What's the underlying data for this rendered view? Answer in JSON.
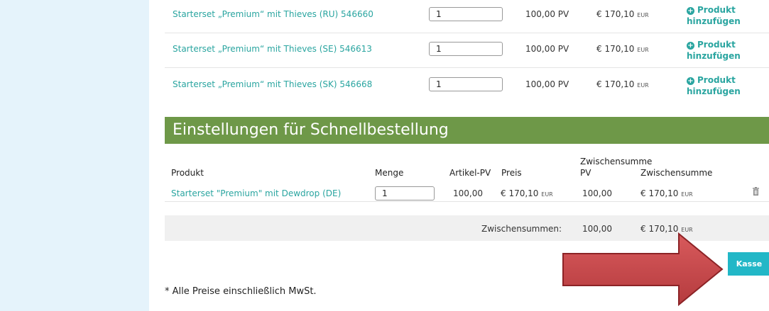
{
  "products": [
    {
      "name": "Starterset „Premium“ mit Thieves (RU) 546660",
      "qty": "1",
      "pv": "100,00 PV",
      "price": "€ 170,10",
      "currency": "EUR",
      "add_line1": "Produkt",
      "add_line2": "hinzufügen"
    },
    {
      "name": "Starterset „Premium“ mit Thieves (SE) 546613",
      "qty": "1",
      "pv": "100,00 PV",
      "price": "€ 170,10",
      "currency": "EUR",
      "add_line1": "Produkt",
      "add_line2": "hinzufügen"
    },
    {
      "name": "Starterset „Premium“ mit Thieves (SK) 546668",
      "qty": "1",
      "pv": "100,00 PV",
      "price": "€ 170,10",
      "currency": "EUR",
      "add_line1": "Produkt",
      "add_line2": "hinzufügen"
    }
  ],
  "quick_order": {
    "title": "Einstellungen für Schnellbestellung",
    "headers": {
      "product": "Produkt",
      "qty": "Menge",
      "item_pv": "Artikel-PV",
      "price": "Preis",
      "subtotal_pv_line1": "Zwischensumme",
      "subtotal_pv_line2": "PV",
      "subtotal": "Zwischensumme"
    },
    "row": {
      "name": "Starterset \"Premium\" mit Dewdrop (DE)",
      "qty": "1",
      "item_pv": "100,00",
      "price": "€ 170,10",
      "currency": "EUR",
      "subtotal_pv": "100,00",
      "subtotal": "€ 170,10"
    },
    "subtotals_label": "Zwischensummen:",
    "subtotals_pv": "100,00",
    "subtotals_value": "€ 170,10",
    "subtotals_currency": "EUR"
  },
  "checkout_label": "Kasse",
  "footnote": "* Alle Preise einschließlich MwSt.",
  "colors": {
    "sidebar": "#e5f3fb",
    "link": "#2aa5a0",
    "section_header": "#6e9848",
    "checkout_button": "#22b7c7",
    "arrow": "#c8494b"
  },
  "icons": {
    "add": "plus-circle-icon",
    "delete": "trash-icon",
    "pointer": "arrow-right-icon"
  }
}
